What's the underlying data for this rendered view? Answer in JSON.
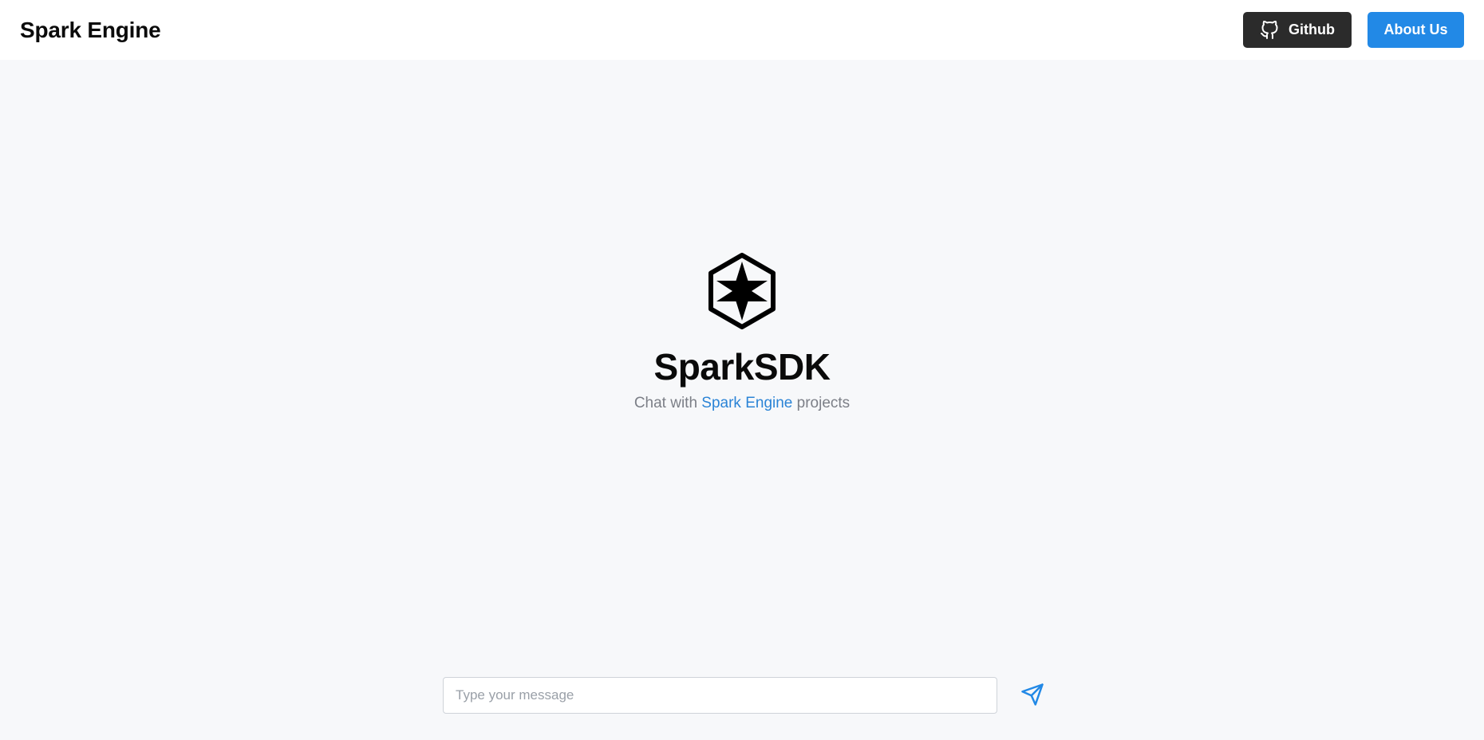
{
  "header": {
    "brand": "Spark Engine",
    "github_label": "Github",
    "about_label": "About Us"
  },
  "hero": {
    "title": "SparkSDK",
    "subtitle_prefix": "Chat with ",
    "subtitle_link": "Spark Engine",
    "subtitle_suffix": " projects",
    "logo_icon": "hexagon-star-logo-icon"
  },
  "composer": {
    "placeholder": "Type your message",
    "value": "",
    "send_icon": "paper-plane-icon"
  },
  "colors": {
    "background": "#f7f8fa",
    "header_bg": "#ffffff",
    "github_button": "#2b2b2b",
    "accent": "#2289e6",
    "link": "#2b84d6",
    "muted_text": "#7c7f87"
  }
}
